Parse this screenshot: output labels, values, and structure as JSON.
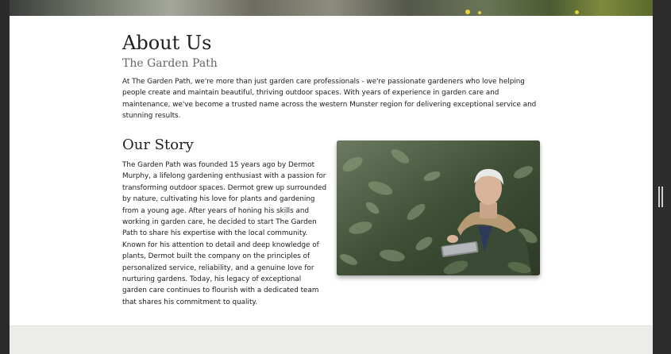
{
  "about": {
    "title": "About Us",
    "subtitle": "The Garden Path",
    "intro": "At The Garden Path, we're more than just garden care professionals - we're passionate gardeners who love helping people create and maintain beautiful, thriving outdoor spaces. With years of experience in garden care and maintenance, we've become a trusted name across the western Munster region for delivering exceptional service and stunning results."
  },
  "story": {
    "title": "Our Story",
    "text": "The Garden Path was founded 15 years ago by Dermot Murphy, a lifelong gardening enthusiast with a passion for transforming outdoor spaces. Dermot grew up surrounded by nature, cultivating his love for plants and gardening from a young age. After years of honing his skills and working in garden care, he decided to start The Garden Path to share his expertise with the local community. Known for his attention to detail and deep knowledge of plants, Dermot built the company on the principles of personalized service, reliability, and a genuine love for nurturing gardens. Today, his legacy of exceptional garden care continues to flourish with a dedicated team that shares his commitment to quality."
  },
  "colors": {
    "page_bg": "#ffffff",
    "footer_bg": "#ecece8",
    "frame_bg": "#2a2a2a"
  }
}
